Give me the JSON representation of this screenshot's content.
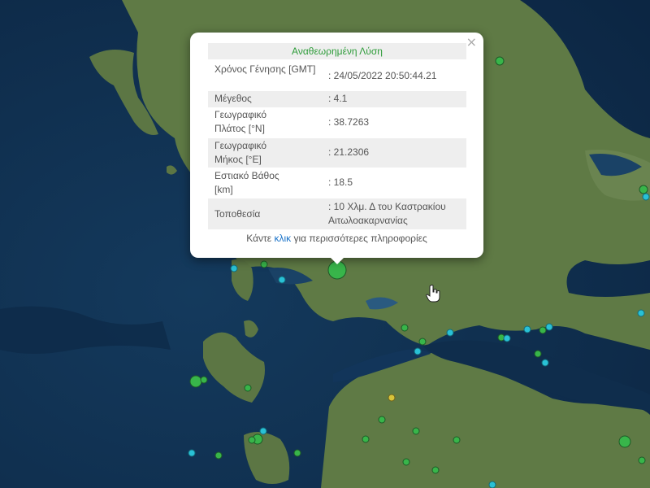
{
  "popup": {
    "title": "Αναθεωρημένη Λύση",
    "close_symbol": "×",
    "rows": [
      {
        "label": "Χρόνος Γένησης [GMT]",
        "value": ": 24/05/2022 20:50:44.21"
      },
      {
        "label": "Μέγεθος",
        "value": ": 4.1"
      },
      {
        "label": "Γεωγραφικό Πλάτος [°N]",
        "value": ": 38.7263"
      },
      {
        "label": "Γεωγραφικό Μήκος [°E]",
        "value": ": 21.2306"
      },
      {
        "label": "Εστιακό Βάθος [km]",
        "value": ": 18.5"
      },
      {
        "label": "Τοποθεσία",
        "value": ": 10 Χλμ. Δ του Καστρακίου Αιτωλοακαρνανίας"
      }
    ],
    "footer_before": "Κάντε ",
    "footer_link": "κλικ",
    "footer_after": " για περισσότερες πληροφορίες"
  },
  "colors": {
    "sea": "#10304f",
    "land": "#5f7a45",
    "green_marker": "#38b54a",
    "cyan_marker": "#29c1d6",
    "yellow_marker": "#d8c43a",
    "title_green": "#2e9c3a",
    "link_blue": "#1a73c9"
  },
  "map": {
    "selected_event_marker": "green-circle-marker",
    "cursor": "hand-cursor-icon"
  }
}
